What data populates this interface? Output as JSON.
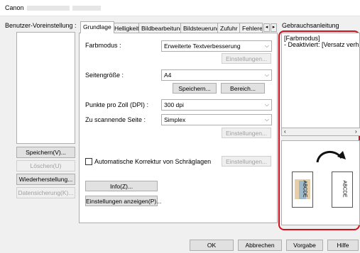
{
  "window": {
    "title": "Canon",
    "title_blurred": ""
  },
  "left": {
    "profiles_label": "Benutzer-Voreinstellung :",
    "buttons": {
      "save": "Speichern(V)...",
      "delete": "Löschen(U)",
      "restore": "Wiederherstellung...",
      "backup": "Datensicherung(K)..."
    }
  },
  "tabs": [
    "Grundlage",
    "Helligkeit",
    "Bildbearbeitung",
    "Bildsteuerung",
    "Zufuhr",
    "Fehlererk"
  ],
  "active_tab": "Grundlage",
  "form": {
    "color_mode_label": "Farbmodus :",
    "color_mode_value": "Erweiterte Textverbesserung",
    "settings_button": "Einstellungen...",
    "page_size_label": "Seitengröße :",
    "page_size_value": "A4",
    "save_button": "Speichern...",
    "area_button": "Bereich...",
    "dpi_label": "Punkte pro Zoll (DPI) :",
    "dpi_value": "300 dpi",
    "scan_side_label": "Zu scannende Seite :",
    "scan_side_value": "Simplex",
    "settings_button_2": "Einstellungen...",
    "auto_correct_label": "Automatische Korrektur von Schräglagen",
    "settings_button_3": "Einstellungen...",
    "info_button": "Info(Z)...",
    "show_settings_button": "Einstellungen anzeigen(P)..."
  },
  "help": {
    "heading": "Gebrauchsanleitung",
    "line1": "[Farbmodus]",
    "line2": "- Deaktiviert: [Versatz verhindern]",
    "preview_text_1": "ABCDE",
    "preview_text_2": "ABCDE"
  },
  "footer": {
    "ok": "OK",
    "cancel": "Abbrechen",
    "default": "Vorgabe",
    "help": "Hilfe"
  },
  "colors": {
    "highlight": "#d0101a",
    "face": "#f0f0f0",
    "border": "#adadad"
  }
}
